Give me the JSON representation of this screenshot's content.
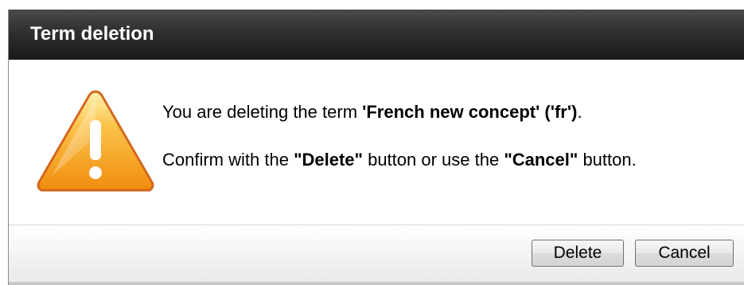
{
  "dialog": {
    "title": "Term deletion",
    "icon": "warning-icon",
    "message": {
      "line1_prefix": "You are deleting the term ",
      "line1_term": "'French new concept' ('fr')",
      "line1_suffix": ".",
      "line2_prefix": "Confirm with the ",
      "line2_delete": "\"Delete\"",
      "line2_middle": " button or use the ",
      "line2_cancel": "\"Cancel\"",
      "line2_suffix": " button."
    },
    "buttons": {
      "delete_label": "Delete",
      "cancel_label": "Cancel"
    }
  },
  "colors": {
    "titlebar": "#2f2f2f",
    "title_text": "#ffffff",
    "warning_orange": "#f39c12"
  }
}
